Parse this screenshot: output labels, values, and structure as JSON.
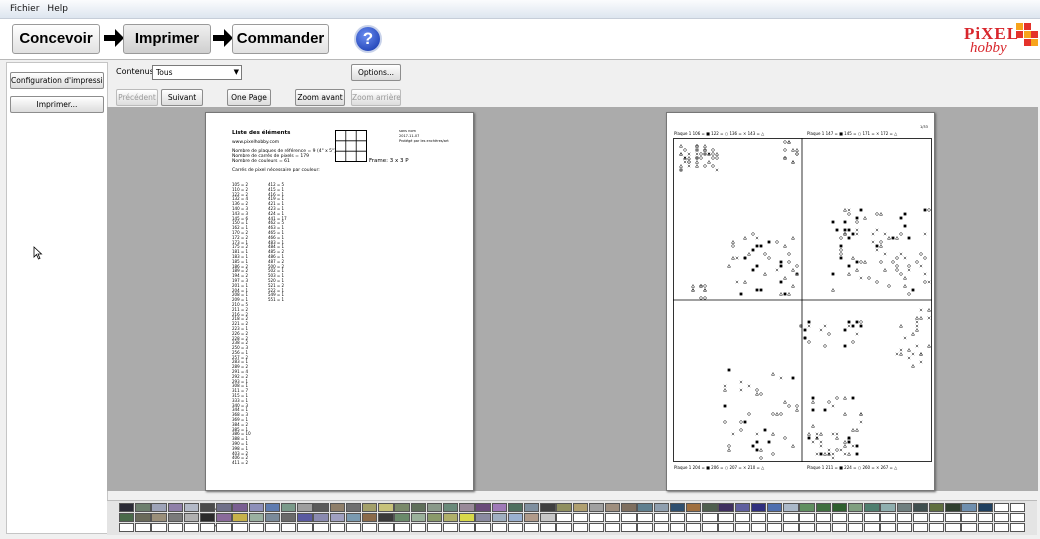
{
  "menu": {
    "items": [
      "Fichier",
      "Help"
    ]
  },
  "toolbar": {
    "steps": [
      "Concevoir",
      "Imprimer",
      "Commander"
    ],
    "help_symbol": "?",
    "logo_pixel": "PiXEL",
    "logo_hobby": "hobby"
  },
  "sidebar": {
    "config_label": "Configuration d'impression...",
    "print_label": "Imprimer..."
  },
  "controls": {
    "contenus_label": "Contenus:",
    "contenus_value": "Tous",
    "options_label": "Options...",
    "precedent_label": "Précédent",
    "suivant_label": "Suivant",
    "onepage_label": "One Page",
    "zoom_in_label": "Zoom avant",
    "zoom_out_label": "Zoom arrière"
  },
  "page1": {
    "title": "Liste des éléments",
    "site": "www.pixelhobby.com",
    "line1": "Nombre de plaques de référence = 9 (4\" x 5\")",
    "line2": "Nombre de carrés de pixels = 179",
    "line3": "Nombre de couleurs = 61",
    "line4": "Carrés de pixel nécessaire par couleur:",
    "frame": "Frame: 3 x 3 P",
    "meta1": "sans nom",
    "meta2": "2017-11-07",
    "meta3": "Protégé par les enchères/art",
    "col1": [
      "105 = 2",
      "110 = 2",
      "122 = 2",
      "132 = 4",
      "136 = 2",
      "140 = 3",
      "143 = 3",
      "145 = 6",
      "150 = 1",
      "162 = 1",
      "170 = 2",
      "172 = 2",
      "173 = 1",
      "175 = 2",
      "181 = 1",
      "183 = 1",
      "185 = 1",
      "186 = 2",
      "189 = 2",
      "194 = 2",
      "197 = 3",
      "201 = 1",
      "204 = 1",
      "208 = 1",
      "209 = 1",
      "210 = 5",
      "211 = 2",
      "216 = 2",
      "218 = 2",
      "221 = 2",
      "223 = 1",
      "226 = 2",
      "228 = 2",
      "238 = 2",
      "250 = 3",
      "256 = 1",
      "257 = 2",
      "283 = 1",
      "289 = 2",
      "291 = 4",
      "292 = 2",
      "293 = 1",
      "308 = 1",
      "311 = 7",
      "315 = 1",
      "333 = 1",
      "340 = 3",
      "344 = 1",
      "368 = 3",
      "369 = 1",
      "384 = 2",
      "385 = 1",
      "386 = 10",
      "388 = 1",
      "390 = 1",
      "398 = 1",
      "403 = 2",
      "406 = 2",
      "411 = 2"
    ],
    "col2": [
      "412 = 5",
      "415 = 1",
      "416 = 1",
      "419 = 1",
      "421 = 1",
      "423 = 1",
      "424 = 1",
      "441 = 17",
      "462 = 5",
      "463 = 1",
      "465 = 1",
      "466 = 1",
      "483 = 1",
      "484 = 1",
      "485 = 2",
      "486 = 1",
      "487 = 2",
      "500 = 2",
      "502 = 1",
      "503 = 1",
      "520 = 1",
      "521 = 2",
      "522 = 1",
      "549 = 1",
      "551 = 1"
    ]
  },
  "page2": {
    "page_number": "1/33",
    "top_left": "Plaque 1  106 = ■  122 = ○  136 = ×  143 = △",
    "top_right": "Plaque 1  147 = ■  145 = ○  171 = ×  172 = △",
    "bottom_left": "Plaque 1  204 = ■  206 = ○  207 = ×  210 = △",
    "bottom_right": "Plaque 1  211 = ■  224 = ○  260 = ×  267 = △"
  },
  "palette": {
    "row1": [
      "#2b2b36",
      "#6d7f6e",
      "#9ea3b8",
      "#8f7fa8",
      "#b3b9c7",
      "#4b4b4b",
      "#6f6f88",
      "#7a5f92",
      "#8d8fb9",
      "#5f7cb0",
      "#7a9a8a",
      "#9e9e9e",
      "#5a5a5a",
      "#8f7f6a",
      "#6f6f6f",
      "#a3a06a",
      "#c7c27a",
      "#7a8a6a",
      "#5f6f5a",
      "#8a9a8a",
      "#6a8a7a",
      "#9a8a9a",
      "#6a4a7a",
      "#a07ab8",
      "#4f6f5f",
      "#7f8f9f",
      "#3f3f3f",
      "#8f8f5f",
      "#b0a070",
      "#a0a0a0",
      "#9f8f7f",
      "#7f6f5f",
      "#5f7f8f",
      "#8f9faf",
      "#2f4f6f",
      "#9f6f3f",
      "#4f5f4f",
      "#3f2f5f",
      "#5f5f9f",
      "#2f2f7f",
      "#4f6faf",
      "#aab8c8",
      "#5f8f5f",
      "#3f6f3f",
      "#2f5f2f",
      "#7f9f7f",
      "#4f7f6f",
      "#8fafaf",
      "#6f7f7f",
      "#3f4f4f",
      "#5f6f3f",
      "#2f3f2f",
      "#6f8faf",
      "#1f3f5f"
    ],
    "row2": [
      "#4a6a4a",
      "#6a6a5a",
      "#9a8f7a",
      "#7a7a7a",
      "#b0b0b0",
      "#2a2a2a",
      "#8a6a9a",
      "#c7b24a",
      "#9ab0a0",
      "#7a8a9a",
      "#6a6a6a",
      "#5a5aa0",
      "#8a8ab0",
      "#a0a0c0",
      "#7a9ab0",
      "#8a6a4a",
      "#3a3a3a",
      "#6a8a6a",
      "#9ab09a",
      "#8a9a6a",
      "#b0b06a",
      "#d8d84a",
      "#8a8aa0",
      "#a0b0c0",
      "#9ab0d0",
      "#b09a8a",
      "#c8c8c8"
    ]
  }
}
